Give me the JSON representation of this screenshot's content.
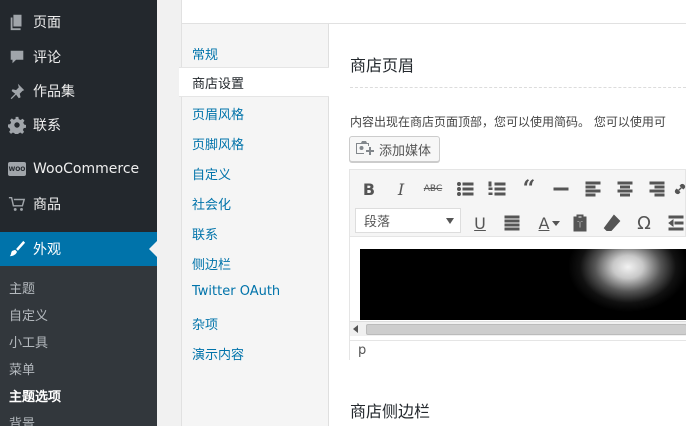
{
  "admin_menu": {
    "items": [
      {
        "label": "页面",
        "icon": "pages-icon"
      },
      {
        "label": "评论",
        "icon": "comments-icon"
      },
      {
        "label": "作品集",
        "icon": "portfolio-pin-icon"
      },
      {
        "label": "联系",
        "icon": "gear-icon"
      },
      {
        "label": "WooCommerce",
        "icon": "woocommerce-icon"
      },
      {
        "label": "商品",
        "icon": "cart-icon"
      },
      {
        "label": "外观",
        "icon": "appearance-brush-icon"
      }
    ],
    "woo_badge_text": "WOO",
    "submenu": [
      {
        "label": "主题"
      },
      {
        "label": "自定义"
      },
      {
        "label": "小工具"
      },
      {
        "label": "菜单"
      },
      {
        "label": "主题选项"
      },
      {
        "label": "背景"
      }
    ],
    "active_menu": "外观",
    "active_submenu": "主题选项",
    "accent_color": "#0073aa"
  },
  "options_nav": {
    "items": [
      {
        "label": "常规"
      },
      {
        "label": "商店设置"
      },
      {
        "label": "页眉风格"
      },
      {
        "label": "页脚风格"
      },
      {
        "label": "自定义"
      },
      {
        "label": "社会化"
      },
      {
        "label": "联系"
      },
      {
        "label": "侧边栏"
      },
      {
        "label": "Twitter OAuth"
      },
      {
        "label": "杂项"
      },
      {
        "label": "演示内容"
      }
    ],
    "active": "商店设置"
  },
  "panel": {
    "section1_title": "商店页眉",
    "description": "内容出现在商店页面顶部，您可以使用简码。 您可以使用可",
    "add_media_label": "添加媒体",
    "editor": {
      "toolbar1": [
        "bold-icon",
        "italic-icon",
        "strikethrough-icon",
        "bullet-list-icon",
        "numbered-list-icon",
        "blockquote-icon",
        "horizontal-rule-icon",
        "align-left-icon",
        "align-center-icon",
        "align-right-icon",
        "link-icon"
      ],
      "format_value": "段落",
      "toolbar2": [
        "underline-icon",
        "justify-icon",
        "text-color-icon",
        "paste-text-icon",
        "clear-formatting-icon",
        "special-character-icon",
        "outdent-icon"
      ],
      "status_path": "p"
    },
    "section2_title": "商店侧边栏"
  }
}
